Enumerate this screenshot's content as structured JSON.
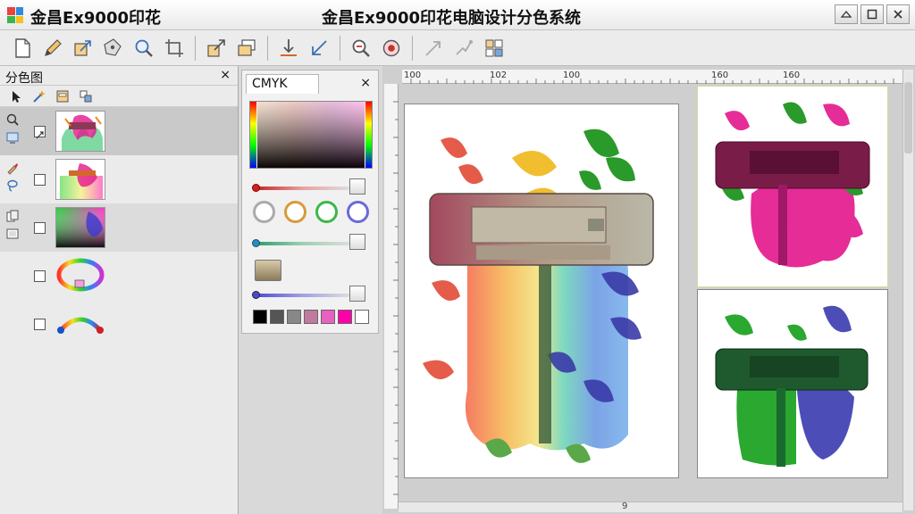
{
  "titlebar": {
    "app_name": "金昌Ex9000印花",
    "window_title": "金昌Ex9000印花电脑设计分色系统"
  },
  "toolbar": {
    "icons": [
      "new-document-icon",
      "pencil-icon",
      "resize-icon",
      "pen-tool-icon",
      "zoom-icon",
      "crop-icon",
      "export-icon",
      "layers-icon",
      "align-bottom-icon",
      "arrow-icon",
      "zoom-out-icon",
      "eye-icon",
      "share-icon",
      "transform-icon",
      "grid-icon"
    ]
  },
  "separation_panel": {
    "title": "分色图",
    "close": "×",
    "layers": [
      {
        "name": "layer-1"
      },
      {
        "name": "layer-2"
      },
      {
        "name": "layer-3"
      },
      {
        "name": "hue-ring"
      },
      {
        "name": "hue-arc"
      }
    ]
  },
  "color_panel": {
    "tab_label": "CMYK",
    "close": "×",
    "swatches": [
      "#000000",
      "#555555",
      "#888888",
      "#c07aa0",
      "#e860c0",
      "#ff00aa",
      "#ffffff"
    ]
  },
  "canvas": {
    "ruler_labels": [
      "100",
      "102",
      "100",
      "160",
      "160"
    ],
    "page_label": "9"
  },
  "colors": {
    "accent_magenta": "#e3168c",
    "accent_green": "#2aa830",
    "printer_body": "#a9a18f"
  }
}
